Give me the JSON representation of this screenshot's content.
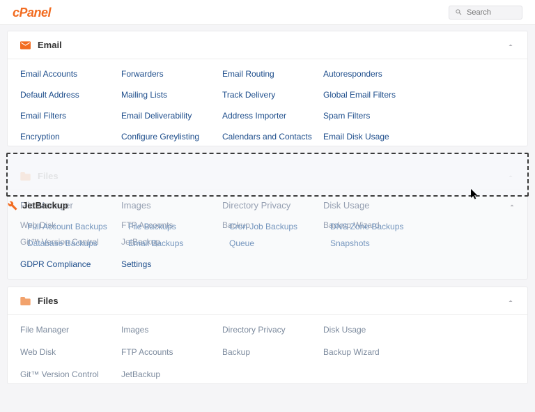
{
  "header": {
    "search_placeholder": "Search"
  },
  "email": {
    "title": "Email",
    "items": [
      "Email Accounts",
      "Forwarders",
      "Email Routing",
      "Autoresponders",
      "Default Address",
      "Mailing Lists",
      "Track Delivery",
      "Global Email Filters",
      "Email Filters",
      "Email Deliverability",
      "Address Importer",
      "Spam Filters",
      "Encryption",
      "Configure Greylisting",
      "Calendars and Contacts",
      "Email Disk Usage"
    ]
  },
  "files_drag": {
    "title": "Files",
    "jetbackup_label": "JetBackup",
    "file_manager_faded": "File Manager",
    "row1": [
      "Images",
      "Directory Privacy",
      "Disk Usage"
    ],
    "r2a": [
      "Web Disk",
      "FTP Accounts",
      "Backup",
      "Backup Wizard"
    ],
    "r2b": [
      "Full Account Backups",
      "File Backups",
      "Cron Job Backups",
      "DNS Zone Backups"
    ],
    "r3a": [
      "Git™ Version Control",
      "JetBackup",
      "",
      ""
    ],
    "r3b": [
      "Database Backups",
      "Email Backups",
      "Queue",
      "Snapshots"
    ],
    "r4": [
      "GDPR Compliance",
      "Settings",
      "",
      ""
    ]
  },
  "files": {
    "title": "Files",
    "items": [
      "File Manager",
      "Images",
      "Directory Privacy",
      "Disk Usage",
      "Web Disk",
      "FTP Accounts",
      "Backup",
      "Backup Wizard",
      "Git™ Version Control",
      "JetBackup",
      "",
      ""
    ]
  }
}
